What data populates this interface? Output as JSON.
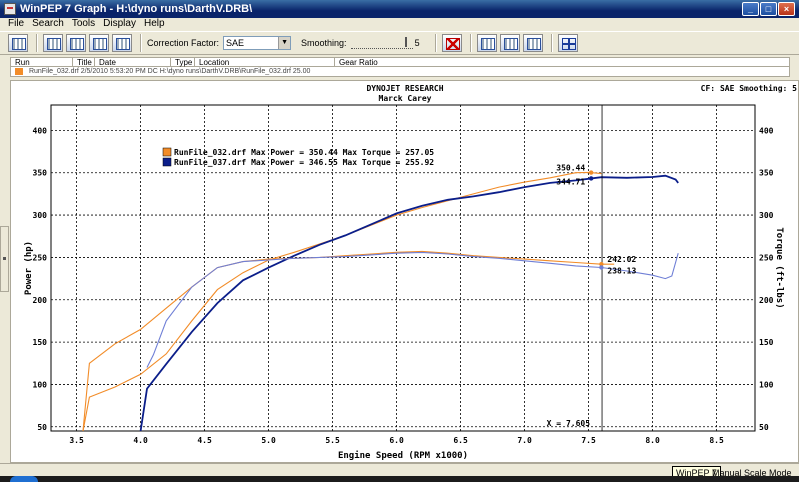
{
  "window": {
    "title": "WinPEP 7    Graph - H:\\dyno runs\\DarthV.DRB\\"
  },
  "menu": [
    "File",
    "Search",
    "Tools",
    "Display",
    "Help"
  ],
  "toolbar": {
    "correction_label": "Correction Factor:",
    "correction_value": "SAE",
    "smoothing_label": "Smoothing:",
    "smoothing_value": "5"
  },
  "run_table": {
    "headers": [
      "Run",
      "Title",
      "Date",
      "Type",
      "Location",
      "Gear Ratio"
    ],
    "row_text": "RunFile_032.drf    2/5/2010 5:53:20 PM   DC   H:\\dyno runs\\DarthV.DRB\\RunFile_032.drf   25.00",
    "row_color": "#f28c28"
  },
  "graph": {
    "header_title": "DYNOJET RESEARCH",
    "header_subtitle": "Marck Carey",
    "header_right": "CF: SAE  Smoothing: 5",
    "legend": [
      {
        "text": "RunFile_032.drf Max Power = 350.44 Max Torque = 257.05",
        "color": "#f28c28"
      },
      {
        "text": "RunFile_037.drf Max Power = 346.55 Max Torque = 255.92",
        "color": "#0b1e8a"
      }
    ],
    "cursor_label": "X = 7.605",
    "cursor_values": [
      {
        "text": "350.44",
        "series": 0,
        "kind": "power"
      },
      {
        "text": "344.71",
        "series": 1,
        "kind": "power"
      },
      {
        "text": "242.02",
        "series": 0,
        "kind": "torque"
      },
      {
        "text": "238.13",
        "series": 1,
        "kind": "torque"
      }
    ]
  },
  "status": {
    "tooltip": "WinPEP 7",
    "mode": "Manual Scale Mode"
  },
  "chart_data": {
    "type": "line",
    "xlabel": "Engine Speed (RPM x1000)",
    "ylabel": "Power (hp)",
    "y2label": "Torque (ft-lbs)",
    "xlim": [
      3.3,
      8.8
    ],
    "ylim": [
      45,
      430
    ],
    "x_ticks": [
      3.5,
      4.0,
      4.5,
      5.0,
      5.5,
      6.0,
      6.5,
      7.0,
      7.5,
      8.0,
      8.5
    ],
    "y_ticks": [
      50,
      100,
      150,
      200,
      250,
      300,
      350,
      400
    ],
    "grid": true,
    "cursor_x": 7.605,
    "series": [
      {
        "name": "RunFile_032.drf power",
        "color": "#f28c28",
        "x": [
          3.55,
          3.6,
          3.8,
          4.0,
          4.2,
          4.4,
          4.6,
          4.8,
          5.0,
          5.2,
          5.4,
          5.6,
          5.8,
          6.0,
          6.2,
          6.4,
          6.6,
          6.8,
          7.0,
          7.2,
          7.4,
          7.5,
          7.6
        ],
        "y": [
          45,
          85,
          97,
          112,
          136,
          175,
          212,
          232,
          247,
          256,
          266,
          276,
          288,
          300,
          309,
          317,
          325,
          333,
          339,
          344,
          350,
          350.44,
          349
        ]
      },
      {
        "name": "RunFile_037.drf power",
        "color": "#0b1e8a",
        "x": [
          4.0,
          4.05,
          4.2,
          4.4,
          4.6,
          4.8,
          5.0,
          5.2,
          5.4,
          5.6,
          5.8,
          6.0,
          6.2,
          6.4,
          6.6,
          6.8,
          7.0,
          7.2,
          7.4,
          7.6,
          7.8,
          8.0,
          8.1,
          8.18,
          8.2
        ],
        "y": [
          45,
          95,
          124,
          162,
          196,
          223,
          238,
          252,
          265,
          276,
          289,
          302,
          311,
          318,
          322,
          327,
          333,
          338,
          341,
          344.71,
          344,
          345,
          346.55,
          342,
          338
        ]
      },
      {
        "name": "RunFile_032.drf torque",
        "color": "#f28c28",
        "x": [
          3.55,
          3.6,
          3.8,
          4.0,
          4.2,
          4.4,
          4.6,
          4.8,
          5.0,
          5.2,
          5.4,
          5.6,
          5.8,
          6.0,
          6.2,
          6.4,
          6.6,
          6.8,
          7.0,
          7.2,
          7.4,
          7.6,
          7.7
        ],
        "y": [
          45,
          125,
          148,
          165,
          190,
          215,
          238,
          245,
          248,
          249,
          250,
          252,
          254,
          256,
          257.05,
          255,
          252,
          250,
          248,
          246,
          244,
          242.02,
          242
        ]
      },
      {
        "name": "RunFile_037.drf torque",
        "color": "#6f7fd6",
        "x": [
          4.05,
          4.1,
          4.2,
          4.4,
          4.6,
          4.8,
          5.0,
          5.2,
          5.4,
          5.6,
          5.8,
          6.0,
          6.2,
          6.4,
          6.6,
          6.8,
          7.0,
          7.2,
          7.4,
          7.6,
          7.8,
          8.0,
          8.1,
          8.15,
          8.2
        ],
        "y": [
          120,
          135,
          175,
          215,
          238,
          245,
          247,
          249,
          250,
          251,
          253,
          255,
          255.92,
          254,
          251,
          249,
          246,
          243,
          240,
          238.13,
          234,
          229,
          225,
          228,
          255
        ]
      }
    ]
  }
}
